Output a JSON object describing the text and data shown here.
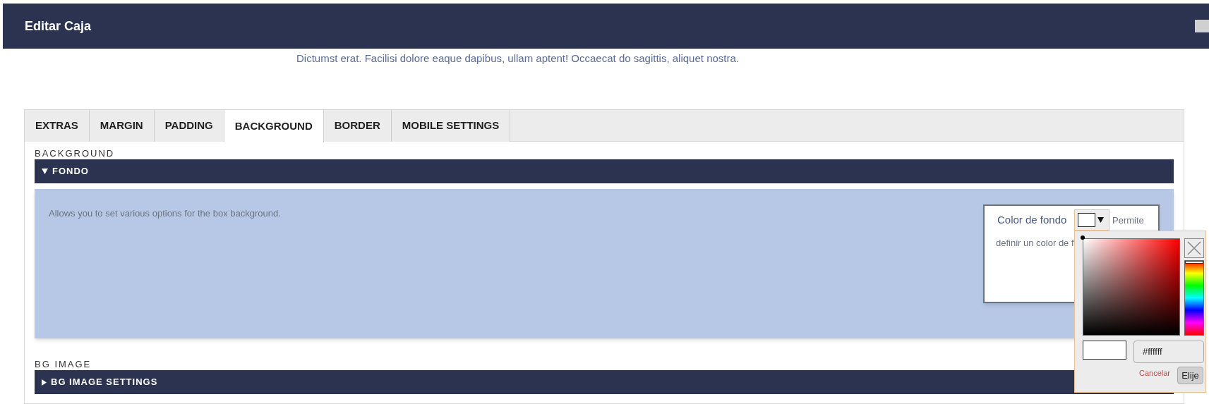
{
  "window": {
    "title": "Editar Caja"
  },
  "background_text": "Dictumst erat. Facilisi dolore eaque dapibus, ullam aptent! Occaecat do sagittis, aliquet nostra.",
  "tabs": [
    {
      "label": "EXTRAS",
      "selected": false
    },
    {
      "label": "MARGIN",
      "selected": false
    },
    {
      "label": "PADDING",
      "selected": false
    },
    {
      "label": "BACKGROUND",
      "selected": true
    },
    {
      "label": "BORDER",
      "selected": false
    },
    {
      "label": "MOBILE SETTINGS",
      "selected": false
    }
  ],
  "sections": [
    {
      "label": "BACKGROUND",
      "header": "FONDO",
      "expanded": true,
      "description": "Allows you to set various options for the box background."
    },
    {
      "label": "BG IMAGE",
      "header": "BG IMAGE SETTINGS",
      "expanded": false
    }
  ],
  "color_field": {
    "label": "Color de fondo",
    "swatch": {
      "color": "#ffffff"
    },
    "help_visible": "Permite",
    "help_line2": "definir un color de f"
  },
  "color_picker": {
    "hue": {
      "level": 0
    },
    "hex_value": "#ffffff",
    "cancel": "Cancelar",
    "choose": "Elije"
  }
}
